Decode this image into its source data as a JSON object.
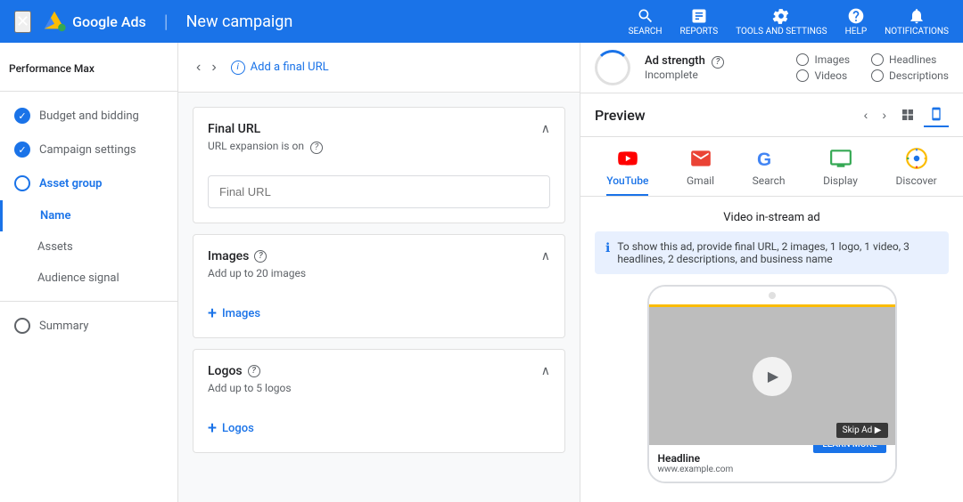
{
  "header": {
    "title": "New campaign",
    "logo_text": "Google Ads",
    "nav_items": [
      {
        "label": "SEARCH",
        "id": "search-nav"
      },
      {
        "label": "REPORTS",
        "id": "reports-nav"
      },
      {
        "label": "TOOLS AND SETTINGS",
        "id": "tools-nav"
      },
      {
        "label": "HELP",
        "id": "help-nav"
      },
      {
        "label": "NOTIFICATIONS",
        "id": "notifications-nav"
      }
    ]
  },
  "sidebar": {
    "items": [
      {
        "id": "performance-max",
        "label": "Performance Max",
        "type": "section",
        "state": "active"
      },
      {
        "id": "budget-and-bidding",
        "label": "Budget and bidding",
        "type": "check"
      },
      {
        "id": "campaign-settings",
        "label": "Campaign settings",
        "type": "check"
      },
      {
        "id": "asset-group",
        "label": "Asset group",
        "type": "circle-active"
      },
      {
        "id": "name",
        "label": "Name",
        "type": "sub-active"
      },
      {
        "id": "assets",
        "label": "Assets",
        "type": "sub"
      },
      {
        "id": "audience-signal",
        "label": "Audience signal",
        "type": "sub"
      },
      {
        "id": "summary",
        "label": "Summary",
        "type": "circle"
      }
    ]
  },
  "progress_bar": {
    "back_label": "‹",
    "forward_label": "›",
    "info_text": "Add a final URL"
  },
  "ad_strength": {
    "title": "Ad strength",
    "status": "Incomplete",
    "checkboxes": [
      {
        "label": "Images"
      },
      {
        "label": "Videos"
      },
      {
        "label": "Headlines"
      },
      {
        "label": "Descriptions"
      }
    ]
  },
  "form": {
    "final_url": {
      "title": "Final URL",
      "subtitle": "URL expansion is on",
      "placeholder": "Final URL"
    },
    "images": {
      "title": "Images",
      "subtitle": "Add up to 20 images",
      "add_label": "Images"
    },
    "logos": {
      "title": "Logos",
      "subtitle": "Add up to 5 logos",
      "add_label": "Logos"
    }
  },
  "preview": {
    "title": "Preview",
    "tabs": [
      {
        "id": "youtube",
        "label": "YouTube"
      },
      {
        "id": "gmail",
        "label": "Gmail"
      },
      {
        "id": "search",
        "label": "Search"
      },
      {
        "id": "display",
        "label": "Display"
      },
      {
        "id": "discover",
        "label": "Discover"
      }
    ],
    "active_tab": "YouTube",
    "ad_type": "Video in-stream ad",
    "info_text": "To show this ad, provide final URL, 2 images, 1 logo, 1 video, 3 headlines, 2 descriptions, and business name",
    "phone": {
      "headline": "Headline",
      "url": "www.example.com",
      "cta": "LEARN MORE",
      "skip_ad": "Skip Ad ▶"
    }
  }
}
